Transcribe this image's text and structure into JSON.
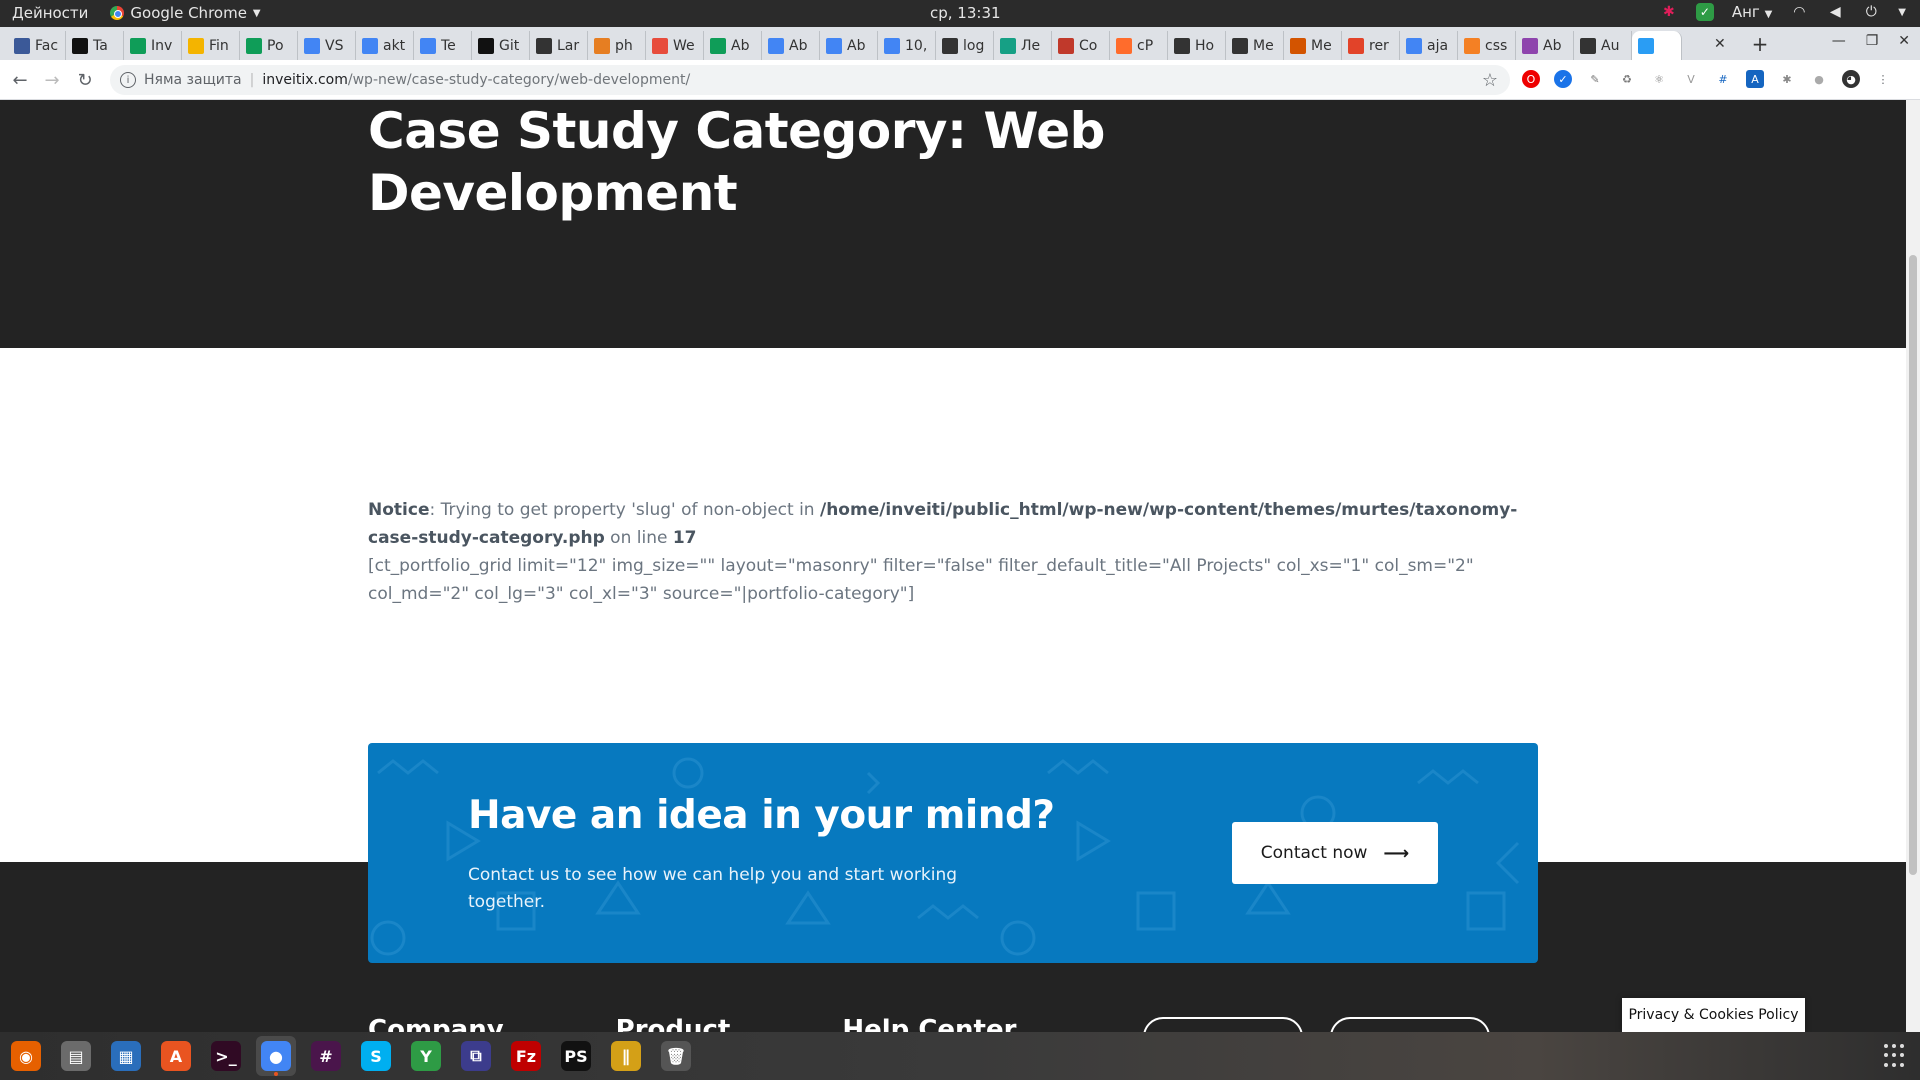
{
  "system": {
    "activities": "Дейности",
    "app_name": "Google Chrome",
    "clock": "ср, 13:31",
    "keyboard_layout": "Анг"
  },
  "tabs": [
    {
      "label": "Fac",
      "icon": "facebook-icon",
      "color": "#3b5998"
    },
    {
      "label": "Ta",
      "icon": "hc-icon",
      "color": "#111111"
    },
    {
      "label": "Inv",
      "icon": "sheets-icon",
      "color": "#0f9d58"
    },
    {
      "label": "Fin",
      "icon": "keep-icon",
      "color": "#f4b400"
    },
    {
      "label": "Po",
      "icon": "sheets-icon",
      "color": "#0f9d58"
    },
    {
      "label": "VS",
      "icon": "docs-icon",
      "color": "#4285f4"
    },
    {
      "label": "akt",
      "icon": "docs-icon",
      "color": "#4285f4"
    },
    {
      "label": "Te",
      "icon": "docs-icon",
      "color": "#4285f4"
    },
    {
      "label": "Git",
      "icon": "github-icon",
      "color": "#111111"
    },
    {
      "label": "Lar",
      "icon": "globe-icon",
      "color": "#333333"
    },
    {
      "label": "ph",
      "icon": "chart-icon",
      "color": "#e67e22"
    },
    {
      "label": "We",
      "icon": "windows-icon",
      "color": "#e74c3c"
    },
    {
      "label": "Ab",
      "icon": "sheets-icon",
      "color": "#0f9d58"
    },
    {
      "label": "Ab",
      "icon": "docs-icon",
      "color": "#4285f4"
    },
    {
      "label": "Ab",
      "icon": "docs-icon",
      "color": "#4285f4"
    },
    {
      "label": "10,",
      "icon": "docs-icon",
      "color": "#4285f4"
    },
    {
      "label": "log",
      "icon": "globe-icon",
      "color": "#333333"
    },
    {
      "label": "Ле",
      "icon": "cloud-icon",
      "color": "#16a085"
    },
    {
      "label": "Co",
      "icon": "heart-icon",
      "color": "#c0392b"
    },
    {
      "label": "cP",
      "icon": "cpanel-icon",
      "color": "#ff6c2c"
    },
    {
      "label": "Ho",
      "icon": "globe-icon",
      "color": "#333333"
    },
    {
      "label": "Me",
      "icon": "globe-icon",
      "color": "#333333"
    },
    {
      "label": "Me",
      "icon": "bag-icon",
      "color": "#d35400"
    },
    {
      "label": "rer",
      "icon": "gitlab-icon",
      "color": "#e24329"
    },
    {
      "label": "aja",
      "icon": "google-icon",
      "color": "#4285f4"
    },
    {
      "label": "css",
      "icon": "stack-icon",
      "color": "#f48024"
    },
    {
      "label": "Ab",
      "icon": "sliders-icon",
      "color": "#8e44ad"
    },
    {
      "label": "Au",
      "icon": "globe-icon",
      "color": "#333333"
    },
    {
      "label": "",
      "icon": "invision-icon",
      "color": "#2a9df4",
      "active": true
    }
  ],
  "address_bar": {
    "security_label": "Няма защита",
    "host": "inveitix.com",
    "path": "/wp-new/case-study-category/web-development/"
  },
  "page": {
    "title": "Case Study Category: Web Development",
    "notice": {
      "label": "Notice",
      "message": ": Trying to get property 'slug' of non-object in ",
      "file": "/home/inveiti/public_html/wp-new/wp-content/themes/murtes/taxonomy-case-study-category.php",
      "line_text": " on line ",
      "line_number": "17"
    },
    "shortcode": "[ct_portfolio_grid limit=\"12\" img_size=\"\" layout=\"masonry\" filter=\"false\" filter_default_title=\"All Projects\" col_xs=\"1\" col_sm=\"2\" col_md=\"2\" col_lg=\"3\" col_xl=\"3\" source=\"|portfolio-category\"]",
    "cta": {
      "heading": "Have an idea in your mind?",
      "text": "Contact us to see how we can help you and start working together.",
      "button_label": "Contact now",
      "button_arrow": "⟶",
      "background": "#0779bf"
    },
    "footer_headings": [
      "Company",
      "Product",
      "Help Center"
    ],
    "privacy_label": "Privacy & Cookies Policy"
  },
  "dock": [
    {
      "name": "firefox-icon",
      "glyph": "◉",
      "color": "#e66000"
    },
    {
      "name": "files-icon",
      "glyph": "▤",
      "color": "#6b6b6b"
    },
    {
      "name": "writer-icon",
      "glyph": "▦",
      "color": "#2a6ebb"
    },
    {
      "name": "software-center-icon",
      "glyph": "A",
      "color": "#e95420"
    },
    {
      "name": "terminal-icon",
      "glyph": ">_",
      "color": "#300a24"
    },
    {
      "name": "chrome-icon",
      "glyph": "●",
      "color": "#4285f4",
      "active": true
    },
    {
      "name": "slack-icon",
      "glyph": "#",
      "color": "#4a154b"
    },
    {
      "name": "skype-icon",
      "glyph": "S",
      "color": "#00aff0"
    },
    {
      "name": "yandex-icon",
      "glyph": "Y",
      "color": "#2e9b45"
    },
    {
      "name": "remmina-icon",
      "glyph": "⧉",
      "color": "#3c3c8c"
    },
    {
      "name": "filezilla-icon",
      "glyph": "Fz",
      "color": "#bf0000"
    },
    {
      "name": "phpstorm-icon",
      "glyph": "PS",
      "color": "#111111"
    },
    {
      "name": "pencils-icon",
      "glyph": "∥",
      "color": "#d4a017"
    },
    {
      "name": "trash-icon",
      "glyph": "🗑",
      "color": "#555555"
    }
  ]
}
